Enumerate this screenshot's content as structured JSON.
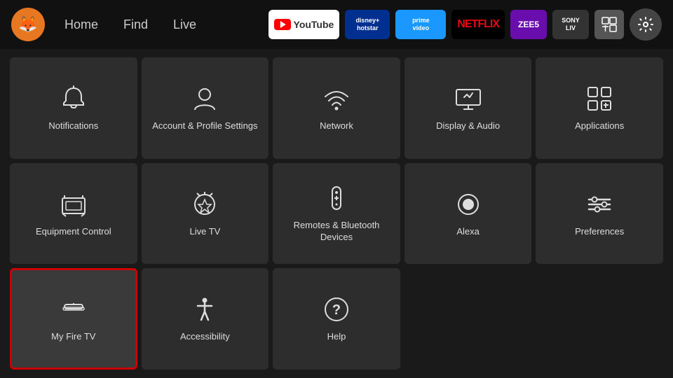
{
  "header": {
    "nav": [
      {
        "label": "Home",
        "id": "home"
      },
      {
        "label": "Find",
        "id": "find"
      },
      {
        "label": "Live",
        "id": "live"
      }
    ],
    "apps": [
      {
        "id": "youtube",
        "label": "▶ YouTube",
        "bg": "#fff",
        "color": "#333",
        "border": "none"
      },
      {
        "id": "disney",
        "label": "disney+ hotstar",
        "bg": "#00308f",
        "color": "#fff"
      },
      {
        "id": "prime",
        "label": "prime video",
        "bg": "#1a98ff",
        "color": "#fff"
      },
      {
        "id": "netflix",
        "label": "NETFLIX",
        "bg": "#000",
        "color": "#e50914"
      },
      {
        "id": "zee5",
        "label": "ZEE5",
        "bg": "#6a0dad",
        "color": "#fff"
      },
      {
        "id": "sony",
        "label": "SONY LIV",
        "bg": "#555",
        "color": "#fff"
      },
      {
        "id": "grid",
        "label": "⊞",
        "bg": "#666",
        "color": "#fff"
      }
    ],
    "settings_icon": "⚙"
  },
  "logo": "🦊",
  "grid": [
    {
      "id": "notifications",
      "label": "Notifications",
      "icon": "bell",
      "selected": false
    },
    {
      "id": "account-profile",
      "label": "Account & Profile Settings",
      "icon": "person",
      "selected": false
    },
    {
      "id": "network",
      "label": "Network",
      "icon": "wifi",
      "selected": false
    },
    {
      "id": "display-audio",
      "label": "Display & Audio",
      "icon": "display",
      "selected": false
    },
    {
      "id": "applications",
      "label": "Applications",
      "icon": "apps",
      "selected": false
    },
    {
      "id": "equipment-control",
      "label": "Equipment Control",
      "icon": "tv",
      "selected": false
    },
    {
      "id": "live-tv",
      "label": "Live TV",
      "icon": "antenna",
      "selected": false
    },
    {
      "id": "remotes-bluetooth",
      "label": "Remotes & Bluetooth Devices",
      "icon": "remote",
      "selected": false
    },
    {
      "id": "alexa",
      "label": "Alexa",
      "icon": "alexa",
      "selected": false
    },
    {
      "id": "preferences",
      "label": "Preferences",
      "icon": "sliders",
      "selected": false
    },
    {
      "id": "my-fire-tv",
      "label": "My Fire TV",
      "icon": "firetv",
      "selected": true
    },
    {
      "id": "accessibility",
      "label": "Accessibility",
      "icon": "accessibility",
      "selected": false
    },
    {
      "id": "help",
      "label": "Help",
      "icon": "help",
      "selected": false
    }
  ]
}
